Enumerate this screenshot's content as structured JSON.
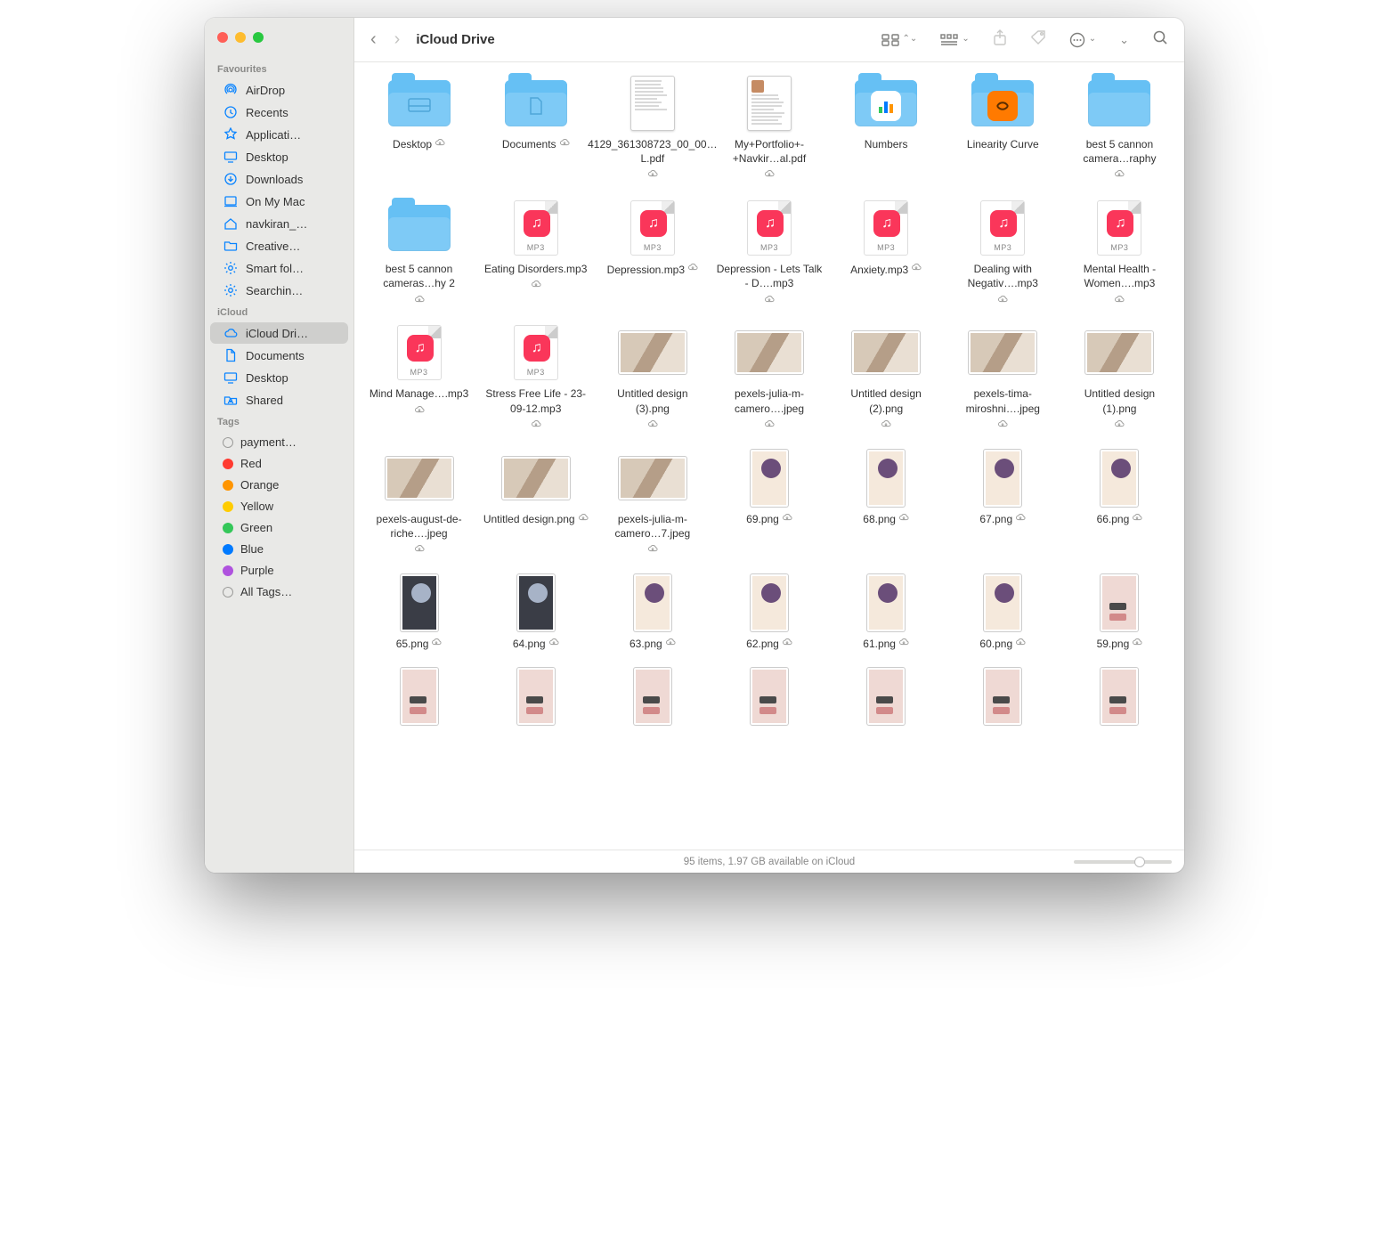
{
  "window": {
    "title": "iCloud Drive"
  },
  "sidebar": {
    "sections": [
      {
        "title": "Favourites",
        "items": [
          {
            "icon": "airdrop",
            "label": "AirDrop"
          },
          {
            "icon": "recents",
            "label": "Recents"
          },
          {
            "icon": "apps",
            "label": "Applicati…"
          },
          {
            "icon": "desktop",
            "label": "Desktop"
          },
          {
            "icon": "downloads",
            "label": "Downloads"
          },
          {
            "icon": "mac",
            "label": "On My Mac"
          },
          {
            "icon": "home",
            "label": "navkiran_…"
          },
          {
            "icon": "folder",
            "label": "Creative…"
          },
          {
            "icon": "gear",
            "label": "Smart fol…"
          },
          {
            "icon": "gear",
            "label": "Searchin…"
          }
        ]
      },
      {
        "title": "iCloud",
        "items": [
          {
            "icon": "cloud",
            "label": "iCloud Dri…",
            "selected": true
          },
          {
            "icon": "doc",
            "label": "Documents"
          },
          {
            "icon": "desktop",
            "label": "Desktop"
          },
          {
            "icon": "shared",
            "label": "Shared"
          }
        ]
      },
      {
        "title": "Tags",
        "items": [
          {
            "tag": "#bdbdbd",
            "label": "payment…",
            "hollow": true
          },
          {
            "tag": "#ff3b30",
            "label": "Red"
          },
          {
            "tag": "#ff9500",
            "label": "Orange"
          },
          {
            "tag": "#ffcc00",
            "label": "Yellow"
          },
          {
            "tag": "#34c759",
            "label": "Green"
          },
          {
            "tag": "#007aff",
            "label": "Blue"
          },
          {
            "tag": "#af52de",
            "label": "Purple"
          },
          {
            "tag": "#bdbdbd",
            "label": "All Tags…",
            "hollow": true
          }
        ]
      }
    ]
  },
  "files": [
    {
      "type": "folder",
      "name": "Desktop",
      "cloud": true,
      "inner": "⌨"
    },
    {
      "type": "folder",
      "name": "Documents",
      "cloud": true,
      "inner": "📄"
    },
    {
      "type": "doc",
      "name": "4129_361308723_00_00…L.pdf",
      "cloud": true
    },
    {
      "type": "doc",
      "name": "My+Portfolio+-+Navkir…al.pdf",
      "cloud": true,
      "headshot": true
    },
    {
      "type": "folder",
      "name": "Numbers",
      "app": "numbers"
    },
    {
      "type": "folder",
      "name": "Linearity Curve",
      "app": "linearity"
    },
    {
      "type": "folder",
      "name": "best 5 cannon camera…raphy",
      "cloud": true
    },
    {
      "type": "folder",
      "name": "best 5 cannon cameras…hy 2",
      "cloud": true
    },
    {
      "type": "mp3",
      "name": "Eating Disorders.mp3",
      "cloud": true
    },
    {
      "type": "mp3",
      "name": "Depression.mp3",
      "cloud": true
    },
    {
      "type": "mp3",
      "name": "Depression - Lets Talk -  D….mp3",
      "cloud": true
    },
    {
      "type": "mp3",
      "name": "Anxiety.mp3",
      "cloud": true
    },
    {
      "type": "mp3",
      "name": "Dealing with Negativ….mp3",
      "cloud": true
    },
    {
      "type": "mp3",
      "name": "Mental Health - Women….mp3",
      "cloud": true
    },
    {
      "type": "mp3",
      "name": "Mind Manage….mp3",
      "cloud": true
    },
    {
      "type": "mp3",
      "name": "Stress Free Life - 23-09-12.mp3",
      "cloud": true
    },
    {
      "type": "photo",
      "name": "Untitled design (3).png",
      "cloud": true
    },
    {
      "type": "photo",
      "name": "pexels-julia-m-camero….jpeg",
      "cloud": true
    },
    {
      "type": "photo",
      "name": "Untitled design (2).png",
      "cloud": true
    },
    {
      "type": "photo",
      "name": "pexels-tima-miroshni….jpeg",
      "cloud": true
    },
    {
      "type": "photo",
      "name": "Untitled design (1).png",
      "cloud": true
    },
    {
      "type": "photo",
      "name": "pexels-august-de-riche….jpeg",
      "cloud": true
    },
    {
      "type": "photo",
      "name": "Untitled design.png",
      "cloud": true
    },
    {
      "type": "photo",
      "name": "pexels-julia-m-camero…7.jpeg",
      "cloud": true
    },
    {
      "type": "photo-tall",
      "name": "69.png",
      "cloud": true,
      "variant": "pale"
    },
    {
      "type": "photo-tall",
      "name": "68.png",
      "cloud": true,
      "variant": "pale"
    },
    {
      "type": "photo-tall",
      "name": "67.png",
      "cloud": true,
      "variant": "pale"
    },
    {
      "type": "photo-tall",
      "name": "66.png",
      "cloud": true,
      "variant": "pale"
    },
    {
      "type": "photo-tall",
      "name": "65.png",
      "cloud": true,
      "variant": "dark"
    },
    {
      "type": "photo-tall",
      "name": "64.png",
      "cloud": true,
      "variant": "dark"
    },
    {
      "type": "photo-tall",
      "name": "63.png",
      "cloud": true,
      "variant": "pale"
    },
    {
      "type": "photo-tall",
      "name": "62.png",
      "cloud": true,
      "variant": "pale"
    },
    {
      "type": "photo-tall",
      "name": "61.png",
      "cloud": true,
      "variant": "pale"
    },
    {
      "type": "photo-tall",
      "name": "60.png",
      "cloud": true,
      "variant": "pale"
    },
    {
      "type": "photo-tall",
      "name": "59.png",
      "cloud": true,
      "variant": "stripe"
    },
    {
      "type": "photo-tall",
      "name": "",
      "variant": "stripe"
    },
    {
      "type": "photo-tall",
      "name": "",
      "variant": "stripe"
    },
    {
      "type": "photo-tall",
      "name": "",
      "variant": "stripe"
    },
    {
      "type": "photo-tall",
      "name": "",
      "variant": "stripe"
    },
    {
      "type": "photo-tall",
      "name": "",
      "variant": "stripe"
    },
    {
      "type": "photo-tall",
      "name": "",
      "variant": "stripe"
    },
    {
      "type": "photo-tall",
      "name": "",
      "variant": "stripe"
    }
  ],
  "status": {
    "text": "95 items, 1.97 GB available on iCloud"
  }
}
